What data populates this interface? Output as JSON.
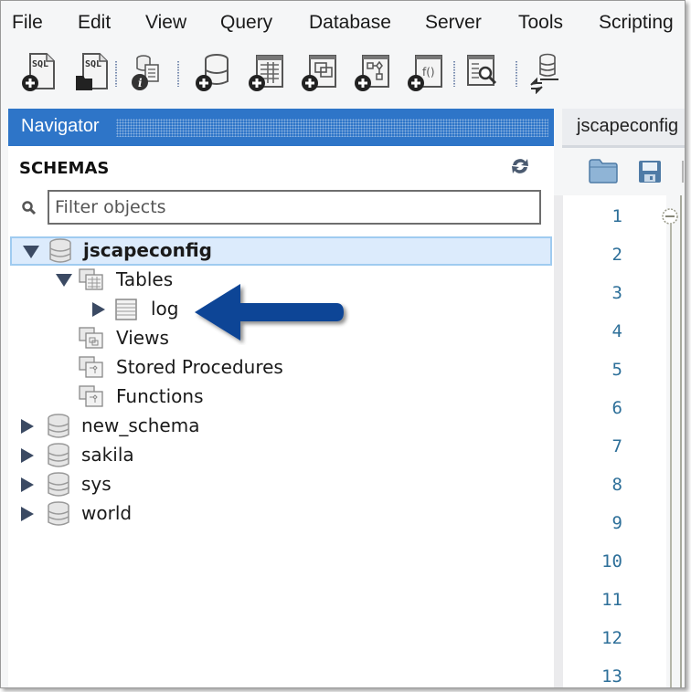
{
  "menu": {
    "items": [
      "File",
      "Edit",
      "View",
      "Query",
      "Database",
      "Server",
      "Tools",
      "Scripting"
    ]
  },
  "toolbar": {
    "buttons": [
      {
        "name": "new-sql-tab",
        "icon": "sql-file-add-icon",
        "text": "SQL"
      },
      {
        "name": "open-sql-script",
        "icon": "sql-file-open-icon",
        "text": "SQL"
      },
      {
        "name": "inspect-object",
        "icon": "info-icon"
      },
      {
        "name": "create-schema",
        "icon": "database-add-icon"
      },
      {
        "name": "create-table",
        "icon": "table-add-icon"
      },
      {
        "name": "create-view",
        "icon": "view-add-icon"
      },
      {
        "name": "create-procedure",
        "icon": "procedure-add-icon"
      },
      {
        "name": "create-function",
        "icon": "function-add-icon",
        "text": "f()"
      },
      {
        "name": "search-table-data",
        "icon": "table-search-icon"
      },
      {
        "name": "reconnect-dbms",
        "icon": "database-reconnect-icon"
      }
    ]
  },
  "navigator": {
    "title": "Navigator",
    "section_label": "SCHEMAS",
    "filter": {
      "placeholder": "Filter objects",
      "value": ""
    },
    "tree": [
      {
        "label": "jscapeconfig",
        "level": 0,
        "type": "schema",
        "expanded": true,
        "selected": true
      },
      {
        "label": "Tables",
        "level": 1,
        "type": "folder-tables",
        "expanded": true
      },
      {
        "label": "log",
        "level": 2,
        "type": "table",
        "expanded": false
      },
      {
        "label": "Views",
        "level": 1,
        "type": "folder-views"
      },
      {
        "label": "Stored Procedures",
        "level": 1,
        "type": "folder-procedures"
      },
      {
        "label": "Functions",
        "level": 1,
        "type": "folder-functions"
      },
      {
        "label": "new_schema",
        "level": 0,
        "type": "schema",
        "expanded": false
      },
      {
        "label": "sakila",
        "level": 0,
        "type": "schema",
        "expanded": false
      },
      {
        "label": "sys",
        "level": 0,
        "type": "schema",
        "expanded": false
      },
      {
        "label": "world",
        "level": 0,
        "type": "schema",
        "expanded": false
      }
    ],
    "annotation": {
      "type": "arrow",
      "points_to": "log",
      "color": "#0f4496"
    }
  },
  "editor": {
    "tab_label": "jscapeconfig",
    "line_numbers": [
      "1",
      "2",
      "3",
      "4",
      "5",
      "6",
      "7",
      "8",
      "9",
      "10",
      "11",
      "12",
      "13"
    ]
  },
  "colors": {
    "navigator_header": "#2e75c8",
    "selected_row": "#dcebfc",
    "line_number": "#2d6f99",
    "arrow": "#0f4496"
  }
}
